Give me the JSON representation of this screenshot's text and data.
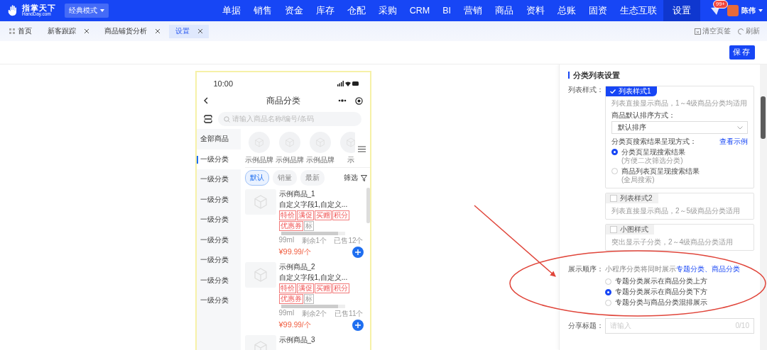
{
  "header": {
    "logo": {
      "name": "指掌天下",
      "domain": "HandDay.com"
    },
    "mode": "经典模式",
    "nav": [
      {
        "label": "单据",
        "selected": false
      },
      {
        "label": "销售",
        "selected": false
      },
      {
        "label": "资金",
        "selected": false
      },
      {
        "label": "库存",
        "selected": false
      },
      {
        "label": "仓配",
        "selected": false
      },
      {
        "label": "采购",
        "selected": false
      },
      {
        "label": "CRM",
        "selected": false
      },
      {
        "label": "BI",
        "selected": false
      },
      {
        "label": "营销",
        "selected": false
      },
      {
        "label": "商品",
        "selected": false
      },
      {
        "label": "资料",
        "selected": false
      },
      {
        "label": "总账",
        "selected": false
      },
      {
        "label": "固资",
        "selected": false
      },
      {
        "label": "生态互联",
        "selected": false
      },
      {
        "label": "设置",
        "selected": true
      }
    ],
    "badge": "99+",
    "user": "陈伟"
  },
  "tabs": [
    {
      "label": "首页",
      "kind": "home",
      "selected": false
    },
    {
      "label": "新客跟踪",
      "kind": "page",
      "selected": false
    },
    {
      "label": "商品铺货分析",
      "kind": "page",
      "selected": false
    },
    {
      "label": "设置",
      "kind": "page",
      "selected": true
    }
  ],
  "tab_actions": {
    "clear": "清空页签",
    "refresh": "刷新"
  },
  "save": "保存",
  "phone": {
    "time": "10:00",
    "title": "商品分类",
    "search_placeholder": "请输入商品名称/编号/条码",
    "categories": [
      {
        "label": "全部商品",
        "selected": false
      },
      {
        "label": "一级分类",
        "selected": true
      },
      {
        "label": "一级分类",
        "selected": false
      },
      {
        "label": "一级分类",
        "selected": false
      },
      {
        "label": "一级分类",
        "selected": false
      },
      {
        "label": "一级分类",
        "selected": false
      },
      {
        "label": "一级分类",
        "selected": false
      },
      {
        "label": "一级分类",
        "selected": false
      },
      {
        "label": "一级分类",
        "selected": false
      }
    ],
    "brands": [
      "示例品牌",
      "示例品牌",
      "示例品牌",
      "示"
    ],
    "sorts": [
      {
        "label": "默认",
        "selected": true
      },
      {
        "label": "销量",
        "selected": false
      },
      {
        "label": "最新",
        "selected": false
      }
    ],
    "filter": "筛选",
    "products": [
      {
        "name": "示例商品_1",
        "fields": "自定义字段1,自定义...",
        "tags": [
          "特价",
          "满促",
          "买赠",
          "积分",
          "优惠券",
          "标"
        ],
        "spec": "99ml",
        "stock": "剩余1个",
        "sold": "已售12个",
        "price_integer": "¥99",
        "price_rest": ".99/个"
      },
      {
        "name": "示例商品_2",
        "fields": "自定义字段1,自定义...",
        "tags": [
          "特价",
          "满促",
          "买赠",
          "积分",
          "优惠券",
          "标"
        ],
        "spec": "99ml",
        "stock": "剩余2个",
        "sold": "已售11个",
        "price_integer": "¥99",
        "price_rest": ".99/个"
      },
      {
        "name": "示例商品_3"
      }
    ]
  },
  "settings": {
    "title": "分类列表设置",
    "list_style_label": "列表样式：",
    "styles": [
      {
        "title": "列表样式1",
        "selected": true,
        "desc": "列表直接显示商品，1～4级商品分类均适用"
      },
      {
        "title": "列表样式2",
        "selected": false,
        "desc": "列表直接显示商品，2～5级商品分类适用"
      },
      {
        "title": "小图样式",
        "selected": false,
        "desc": "突出显示子分类，2～4级商品分类适用"
      }
    ],
    "sort_label": "商品默认排序方式：",
    "sort_value": "默认排序",
    "search_label": "分类页搜索结果呈现方式：",
    "example_link": "查看示例",
    "search_options": [
      {
        "label": "分类页呈现搜索结果",
        "hint": "(方便二次筛选分类)",
        "selected": true
      },
      {
        "label": "商品列表页呈现搜索结果",
        "hint": "(全局搜索)",
        "selected": false
      }
    ],
    "order_label": "展示顺序：",
    "order_note": "小程序分类将同时展示",
    "order_note_link": "专题分类、商品分类",
    "order_options": [
      {
        "label": "专题分类展示在商品分类上方",
        "selected": false
      },
      {
        "label": "专题分类展示在商品分类下方",
        "selected": true
      },
      {
        "label": "专题分类与商品分类混排展示",
        "selected": false
      }
    ],
    "share_label": "分享标题：",
    "share_placeholder": "请输入",
    "share_counter": "0/10"
  }
}
